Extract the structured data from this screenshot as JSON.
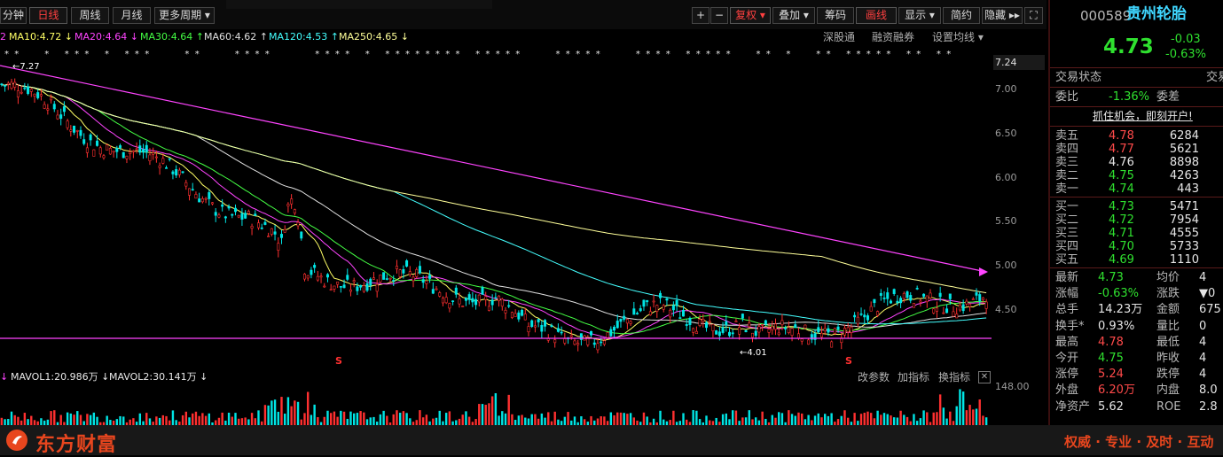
{
  "toolbar": {
    "periods": [
      "分钟",
      "日线",
      "周线",
      "月线",
      "更多周期 ▾"
    ],
    "plus": "+",
    "minus": "−",
    "tools": [
      "复权 ▾",
      "叠加 ▾",
      "筹码",
      "画线",
      "显示 ▾",
      "简约",
      "隐藏 ▸▸"
    ],
    "expand": "⛶"
  },
  "ma_legend": [
    {
      "text": "MA10:4.72 ↓",
      "color": "#ffff66"
    },
    {
      "text": "MA20:4.64 ↓",
      "color": "#ff44ff"
    },
    {
      "text": "MA30:4.64 ↑",
      "color": "#44ff44"
    },
    {
      "text": "MA60:4.62 ↑",
      "color": "#e0e0e0"
    },
    {
      "text": "MA120:4.53 ↑",
      "color": "#44ffff"
    },
    {
      "text": "MA250:4.65 ↓",
      "color": "#ffff99"
    }
  ],
  "chart_links": [
    "深股通",
    "融资融券",
    "设置均线 ▾"
  ],
  "price_axis": [
    "7.24",
    "7.00",
    "6.50",
    "6.00",
    "5.50",
    "5.00",
    "4.50"
  ],
  "annotations": {
    "high": "7.27",
    "low": "4.01",
    "marker": "S"
  },
  "volume": {
    "mavol1": "MAVOL1:20.986万 ↓",
    "mavol2": "MAVOL2:30.141万 ↓",
    "tools": [
      "改参数",
      "加指标",
      "换指标"
    ],
    "close": "✕",
    "axis_top": "148.00"
  },
  "stock": {
    "code": "000589",
    "name": "贵州轮胎",
    "price": "4.73",
    "change": "-0.03",
    "change_pct": "-0.63%"
  },
  "panel": {
    "status_label": "交易状态",
    "status_right": "交易",
    "weibi_label": "委比",
    "weibi_value": "-1.36%",
    "weicha_label": "委差",
    "promo": "抓住机会，即刻开户!"
  },
  "sell_orders": [
    {
      "label": "卖五",
      "price": "4.78",
      "vol": "6284",
      "color": "#ff4a4a"
    },
    {
      "label": "卖四",
      "price": "4.77",
      "vol": "5621",
      "color": "#ff4a4a"
    },
    {
      "label": "卖三",
      "price": "4.76",
      "vol": "8898",
      "color": "#e6e6e6"
    },
    {
      "label": "卖二",
      "price": "4.75",
      "vol": "4263",
      "color": "#2fe02f"
    },
    {
      "label": "卖一",
      "price": "4.74",
      "vol": "443",
      "color": "#2fe02f"
    }
  ],
  "buy_orders": [
    {
      "label": "买一",
      "price": "4.73",
      "vol": "5471",
      "color": "#2fe02f"
    },
    {
      "label": "买二",
      "price": "4.72",
      "vol": "7954",
      "color": "#2fe02f"
    },
    {
      "label": "买三",
      "price": "4.71",
      "vol": "4555",
      "color": "#2fe02f"
    },
    {
      "label": "买四",
      "price": "4.70",
      "vol": "5733",
      "color": "#2fe02f"
    },
    {
      "label": "买五",
      "price": "4.69",
      "vol": "1110",
      "color": "#2fe02f"
    }
  ],
  "quote_rows": [
    {
      "l1": "最新",
      "v1": "4.73",
      "c1": "#2fe02f",
      "l2": "均价",
      "v2": "4"
    },
    {
      "l1": "涨幅",
      "v1": "-0.63%",
      "c1": "#2fe02f",
      "l2": "涨跌",
      "v2": "▼0"
    },
    {
      "l1": "总手",
      "v1": "14.23万",
      "c1": "#e6e6e6",
      "l2": "金额",
      "v2": "675"
    },
    {
      "l1": "换手*",
      "v1": "0.93%",
      "c1": "#e6e6e6",
      "l2": "量比",
      "v2": "0"
    },
    {
      "l1": "最高",
      "v1": "4.78",
      "c1": "#ff4a4a",
      "l2": "最低",
      "v2": "4"
    },
    {
      "l1": "今开",
      "v1": "4.75",
      "c1": "#2fe02f",
      "l2": "昨收",
      "v2": "4"
    },
    {
      "l1": "涨停",
      "v1": "5.24",
      "c1": "#ff4a4a",
      "l2": "跌停",
      "v2": "4"
    },
    {
      "l1": "外盘",
      "v1": "6.20万",
      "c1": "#ff4a4a",
      "l2": "内盘",
      "v2": "8.0"
    },
    {
      "l1": "净资产",
      "v1": "5.62",
      "c1": "#e6e6e6",
      "l2": "ROE",
      "v2": "2.8"
    }
  ],
  "footer": {
    "brand": "东方财富",
    "slogan": "权威 · 专业 · 及时 · 互动"
  },
  "colors": {
    "up": "#ff3030",
    "down": "#00e5e5",
    "trend": "#ff44ff",
    "accent": "#ff4a4a"
  }
}
